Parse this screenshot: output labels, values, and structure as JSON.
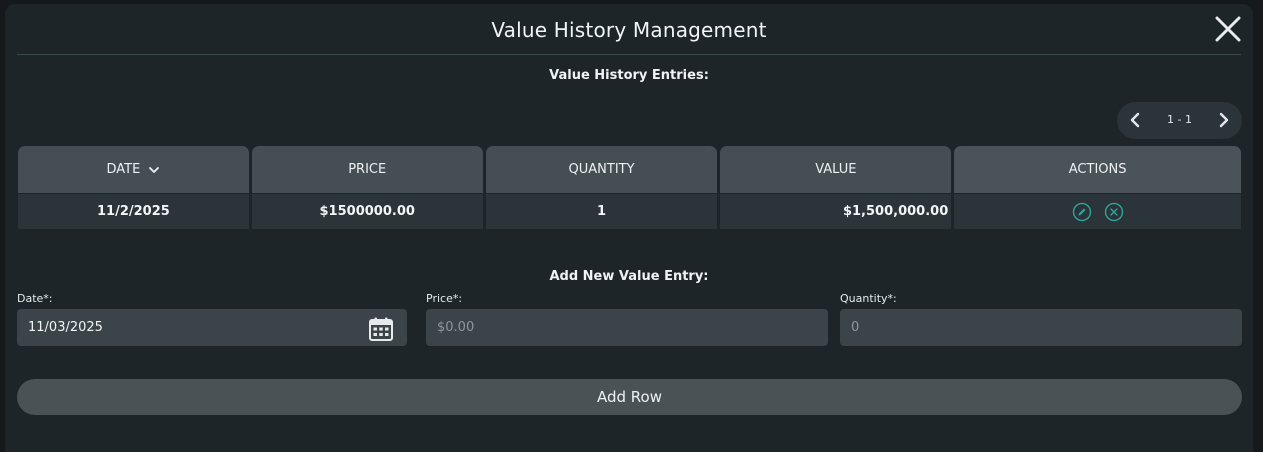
{
  "modal": {
    "title": "Value History Management",
    "close_icon": "close-icon"
  },
  "entries": {
    "section_label": "Value History Entries:",
    "pagination": {
      "range": "1 - 1",
      "prev_icon": "chevron-left-icon",
      "next_icon": "chevron-right-icon"
    },
    "columns": [
      "DATE",
      "PRICE",
      "QUANTITY",
      "VALUE",
      "ACTIONS"
    ],
    "sort_icon": "chevron-down-icon",
    "rows": [
      {
        "date": "11/2/2025",
        "price": "$1500000.00",
        "quantity": "1",
        "value": "$1,500,000.00",
        "actions": [
          "edit-icon",
          "delete-icon"
        ]
      }
    ]
  },
  "add_entry": {
    "section_label": "Add New Value Entry:",
    "date": {
      "label": "Date*:",
      "value": "11/03/2025",
      "icon": "calendar-icon"
    },
    "price": {
      "label": "Price*:",
      "placeholder": "$0.00"
    },
    "quantity": {
      "label": "Quantity*:",
      "placeholder": "0"
    },
    "button_label": "Add Row"
  },
  "colors": {
    "background": "#1d2529",
    "header_cell": "#444e53",
    "data_cell": "#2a3439",
    "accent_teal": "#2fa8a0",
    "button": "#4a5256"
  }
}
